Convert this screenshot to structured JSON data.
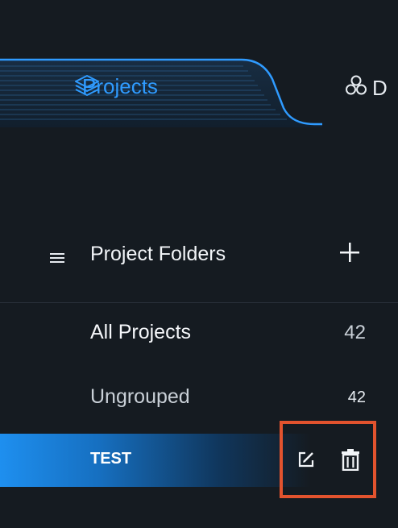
{
  "tabs": {
    "active": {
      "label": "Projects",
      "icon": "layers-icon"
    },
    "next": {
      "label": "D",
      "icon": "clusters-icon"
    }
  },
  "folders": {
    "title": "Project Folders",
    "menu_icon": "menu-icon",
    "add_icon": "plus-icon",
    "items": [
      {
        "label": "All Projects",
        "count": "42"
      },
      {
        "label": "Ungrouped",
        "count": "42"
      },
      {
        "label": "TEST",
        "selected": true
      }
    ]
  },
  "colors": {
    "background": "#151b21",
    "accent": "#2f9bff",
    "highlight": "#e2532e"
  }
}
